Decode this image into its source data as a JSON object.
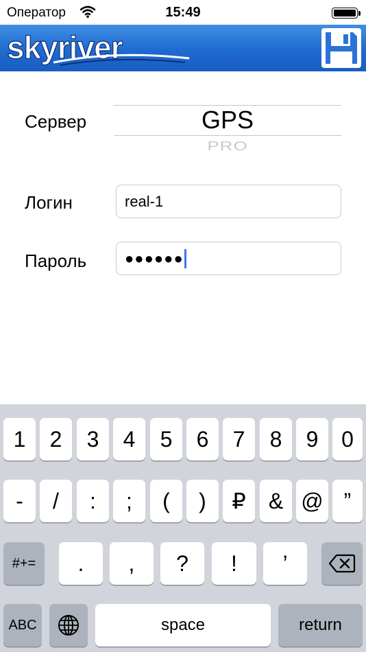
{
  "status_bar": {
    "carrier": "Оператор",
    "time": "15:49"
  },
  "header": {
    "logo_text": "skyriver"
  },
  "form": {
    "server_label": "Сервер",
    "server_selected": "GPS",
    "server_next": "PRO",
    "login_label": "Логин",
    "login_value": "real-1",
    "password_label": "Пароль",
    "password_masked": "●●●●●●"
  },
  "keyboard": {
    "row1": [
      "1",
      "2",
      "3",
      "4",
      "5",
      "6",
      "7",
      "8",
      "9",
      "0"
    ],
    "row2": [
      "-",
      "/",
      ":",
      ";",
      "(",
      ")",
      "₽",
      "&",
      "@",
      "”"
    ],
    "row3_mode": "#+=",
    "row3": [
      ".",
      ",",
      "?",
      "!",
      "’"
    ],
    "abc": "ABC",
    "space": "space",
    "return": "return"
  },
  "colors": {
    "header_blue": "#1f6ad0",
    "keyboard_bg": "#d1d5db",
    "caret": "#3478f6"
  }
}
